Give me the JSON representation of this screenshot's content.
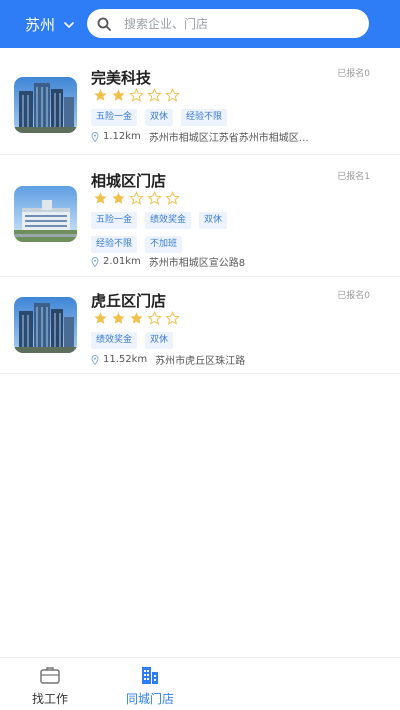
{
  "header": {
    "city": "苏州",
    "search_placeholder": "搜索企业、门店"
  },
  "stores": [
    {
      "name": "完美科技",
      "signed": "已报名0",
      "rating": 2,
      "tags": [
        "五险一金",
        "双休",
        "经验不限"
      ],
      "distance": "1.12km",
      "address": "苏州市相城区江苏省苏州市相城区…"
    },
    {
      "name": "相城区门店",
      "signed": "已报名1",
      "rating": 2,
      "tags": [
        "五险一金",
        "绩效奖金",
        "双休",
        "经验不限",
        "不加班"
      ],
      "distance": "2.01km",
      "address": "苏州市相城区宣公路8"
    },
    {
      "name": "虎丘区门店",
      "signed": "已报名0",
      "rating": 3,
      "tags": [
        "绩效奖金",
        "双休"
      ],
      "distance": "11.52km",
      "address": "苏州市虎丘区珠江路"
    }
  ],
  "tabbar": {
    "tabs": [
      {
        "label": "找工作",
        "icon": "briefcase-icon",
        "active": false
      },
      {
        "label": "同城门店",
        "icon": "buildings-icon",
        "active": true
      }
    ]
  },
  "colors": {
    "header_bg": "#2e7cf6",
    "star_filled": "#f2c04d",
    "tag_bg": "#ecf3fd",
    "tag_text": "#3a7bd5",
    "active_tab": "#2e7cf6"
  }
}
